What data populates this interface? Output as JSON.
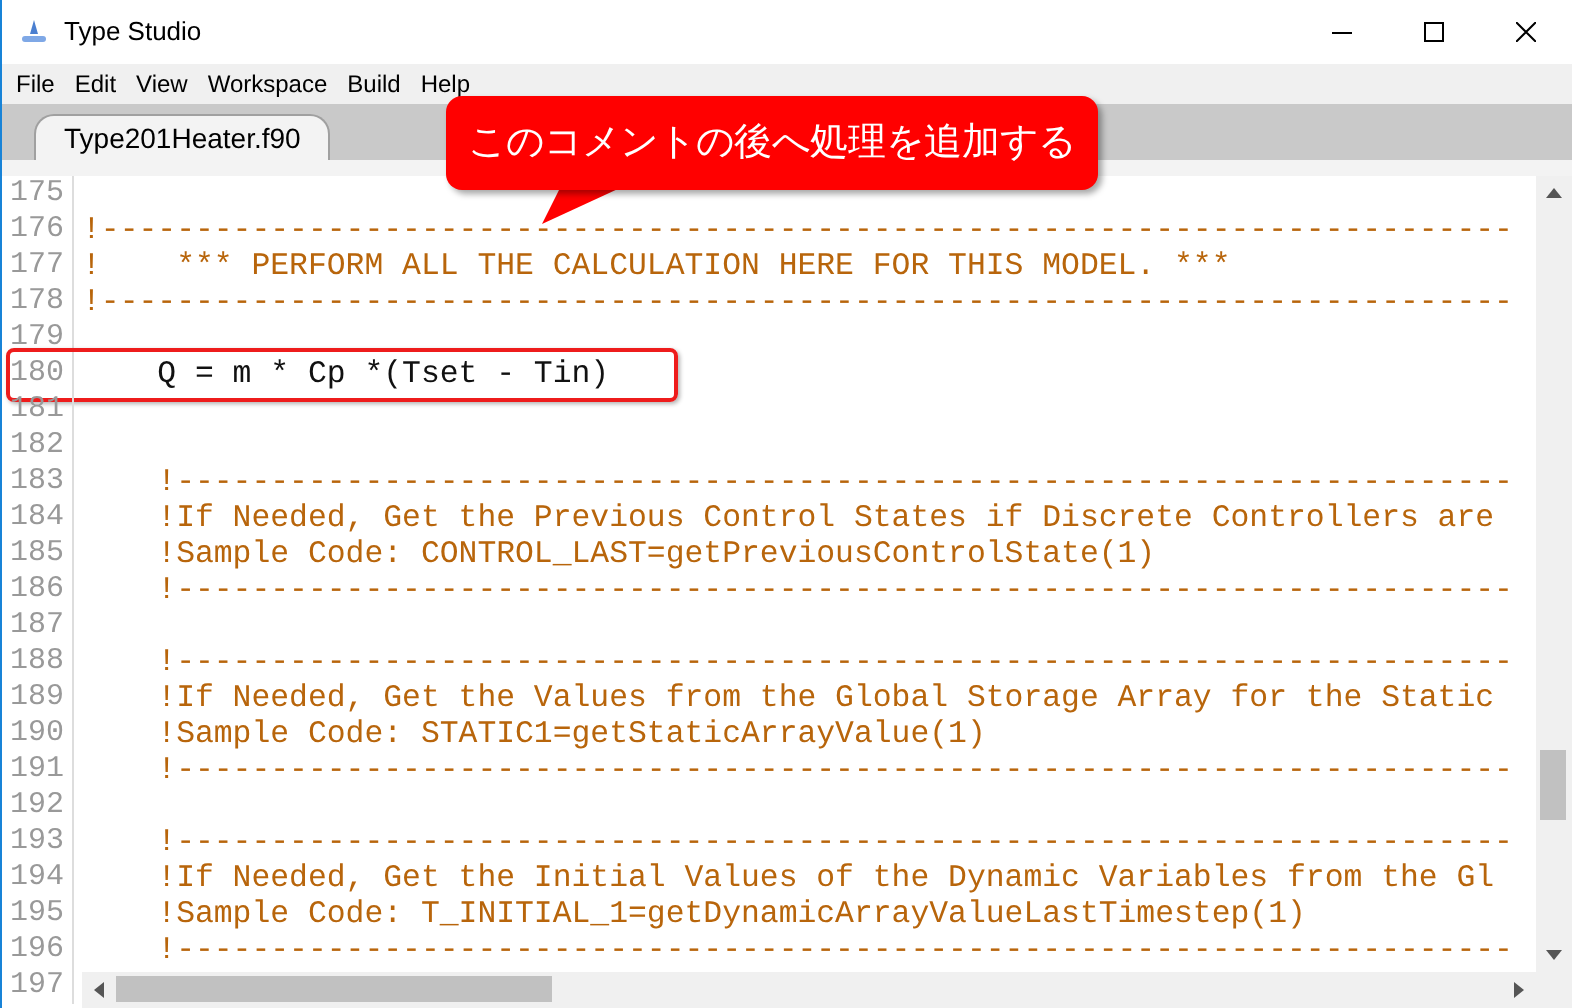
{
  "window": {
    "title": "Type Studio"
  },
  "menu": [
    "File",
    "Edit",
    "View",
    "Workspace",
    "Build",
    "Help"
  ],
  "tabs": [
    {
      "label": "Type201Heater.f90",
      "selected": true
    }
  ],
  "callout": {
    "text": "このコメントの後へ処理を追加する"
  },
  "lines": [
    {
      "number": "175",
      "kind": "blank",
      "highlighted": false
    },
    {
      "number": "176",
      "kind": "comment",
      "text": "!---------------------------------------------------------------------------",
      "highlighted": false
    },
    {
      "number": "177",
      "kind": "comment",
      "text": "!    *** PERFORM ALL THE CALCULATION HERE FOR THIS MODEL. ***",
      "highlighted": false
    },
    {
      "number": "178",
      "kind": "comment",
      "text": "!---------------------------------------------------------------------------",
      "highlighted": false
    },
    {
      "number": "179",
      "kind": "blank",
      "highlighted": false
    },
    {
      "number": "180",
      "kind": "code",
      "text": "    Q = m * Cp *(Tset - Tin)",
      "highlighted": true
    },
    {
      "number": "181",
      "kind": "blank",
      "highlighted": false
    },
    {
      "number": "182",
      "kind": "blank",
      "highlighted": false
    },
    {
      "number": "183",
      "kind": "comment",
      "text": "    !-----------------------------------------------------------------------",
      "highlighted": false
    },
    {
      "number": "184",
      "kind": "comment",
      "text": "    !If Needed, Get the Previous Control States if Discrete Controllers are",
      "highlighted": false
    },
    {
      "number": "185",
      "kind": "comment",
      "text": "    !Sample Code: CONTROL_LAST=getPreviousControlState(1)",
      "highlighted": false
    },
    {
      "number": "186",
      "kind": "comment",
      "text": "    !-----------------------------------------------------------------------",
      "highlighted": false
    },
    {
      "number": "187",
      "kind": "blank",
      "highlighted": false
    },
    {
      "number": "188",
      "kind": "comment",
      "text": "    !-----------------------------------------------------------------------",
      "highlighted": false
    },
    {
      "number": "189",
      "kind": "comment",
      "text": "    !If Needed, Get the Values from the Global Storage Array for the Static",
      "highlighted": false
    },
    {
      "number": "190",
      "kind": "comment",
      "text": "    !Sample Code: STATIC1=getStaticArrayValue(1)",
      "highlighted": false
    },
    {
      "number": "191",
      "kind": "comment",
      "text": "    !-----------------------------------------------------------------------",
      "highlighted": false
    },
    {
      "number": "192",
      "kind": "blank",
      "highlighted": false
    },
    {
      "number": "193",
      "kind": "comment",
      "text": "    !-----------------------------------------------------------------------",
      "highlighted": false
    },
    {
      "number": "194",
      "kind": "comment",
      "text": "    !If Needed, Get the Initial Values of the Dynamic Variables from the Gl",
      "highlighted": false
    },
    {
      "number": "195",
      "kind": "comment",
      "text": "    !Sample Code: T_INITIAL_1=getDynamicArrayValueLastTimestep(1)",
      "highlighted": false
    },
    {
      "number": "196",
      "kind": "comment",
      "text": "    !-----------------------------------------------------------------------",
      "highlighted": false
    },
    {
      "number": "197",
      "kind": "blank",
      "highlighted": false
    }
  ]
}
